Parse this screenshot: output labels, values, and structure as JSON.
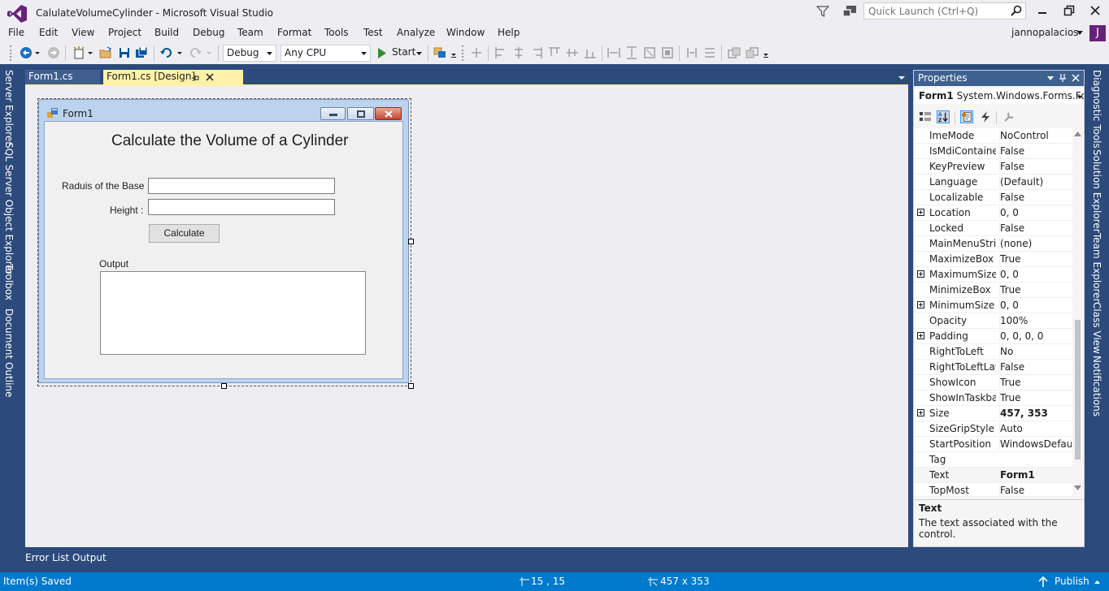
{
  "window": {
    "title": "CalulateVolumeCylinder - Microsoft Visual Studio",
    "quick_launch_placeholder": "Quick Launch (Ctrl+Q)",
    "user": "jannopalacios",
    "avatar_letter": "J"
  },
  "menu": [
    "File",
    "Edit",
    "View",
    "Project",
    "Build",
    "Debug",
    "Team",
    "Format",
    "Tools",
    "Test",
    "Analyze",
    "Window",
    "Help"
  ],
  "toolbar": {
    "config": "Debug",
    "platform": "Any CPU",
    "start": "Start"
  },
  "left_tabs": [
    "Server Explorer",
    "SQL Server Object Explorer",
    "Toolbox",
    "Document Outline"
  ],
  "doc_tabs": [
    "Form1.cs",
    "Form1.cs [Design]"
  ],
  "form": {
    "title": "Form1",
    "heading": "Calculate the Volume of a Cylinder",
    "radius_label": "Raduis of the Base :",
    "height_label": "Height :",
    "calculate_button": "Calculate",
    "output_label": "Output"
  },
  "properties": {
    "title": "Properties",
    "object_name": "Form1",
    "object_type": "System.Windows.Forms.Form",
    "rows": [
      {
        "name": "ImeMode",
        "value": "NoControl"
      },
      {
        "name": "IsMdiContainer",
        "value": "False"
      },
      {
        "name": "KeyPreview",
        "value": "False"
      },
      {
        "name": "Language",
        "value": "(Default)"
      },
      {
        "name": "Localizable",
        "value": "False"
      },
      {
        "name": "Location",
        "value": "0, 0",
        "expandable": true
      },
      {
        "name": "Locked",
        "value": "False"
      },
      {
        "name": "MainMenuStrip",
        "value": "(none)"
      },
      {
        "name": "MaximizeBox",
        "value": "True"
      },
      {
        "name": "MaximumSize",
        "value": "0, 0",
        "expandable": true
      },
      {
        "name": "MinimizeBox",
        "value": "True"
      },
      {
        "name": "MinimumSize",
        "value": "0, 0",
        "expandable": true
      },
      {
        "name": "Opacity",
        "value": "100%"
      },
      {
        "name": "Padding",
        "value": "0, 0, 0, 0",
        "expandable": true
      },
      {
        "name": "RightToLeft",
        "value": "No"
      },
      {
        "name": "RightToLeftLayout",
        "value": "False"
      },
      {
        "name": "ShowIcon",
        "value": "True"
      },
      {
        "name": "ShowInTaskbar",
        "value": "True"
      },
      {
        "name": "Size",
        "value": "457, 353",
        "expandable": true,
        "bold": true
      },
      {
        "name": "SizeGripStyle",
        "value": "Auto"
      },
      {
        "name": "StartPosition",
        "value": "WindowsDefaultLocation"
      },
      {
        "name": "Tag",
        "value": ""
      },
      {
        "name": "Text",
        "value": "Form1",
        "bold": true,
        "selected": true
      },
      {
        "name": "TopMost",
        "value": "False"
      }
    ],
    "desc_title": "Text",
    "desc_text": "The text associated with the control."
  },
  "right_tabs": [
    "Diagnostic Tools",
    "Solution Explorer",
    "Team Explorer",
    "Class View",
    "Notifications"
  ],
  "bottom_tabs": [
    "Error List",
    "Output"
  ],
  "status": {
    "text": "Item(s) Saved",
    "position": "15 , 15",
    "size": "457 x 353",
    "publish": "Publish"
  }
}
